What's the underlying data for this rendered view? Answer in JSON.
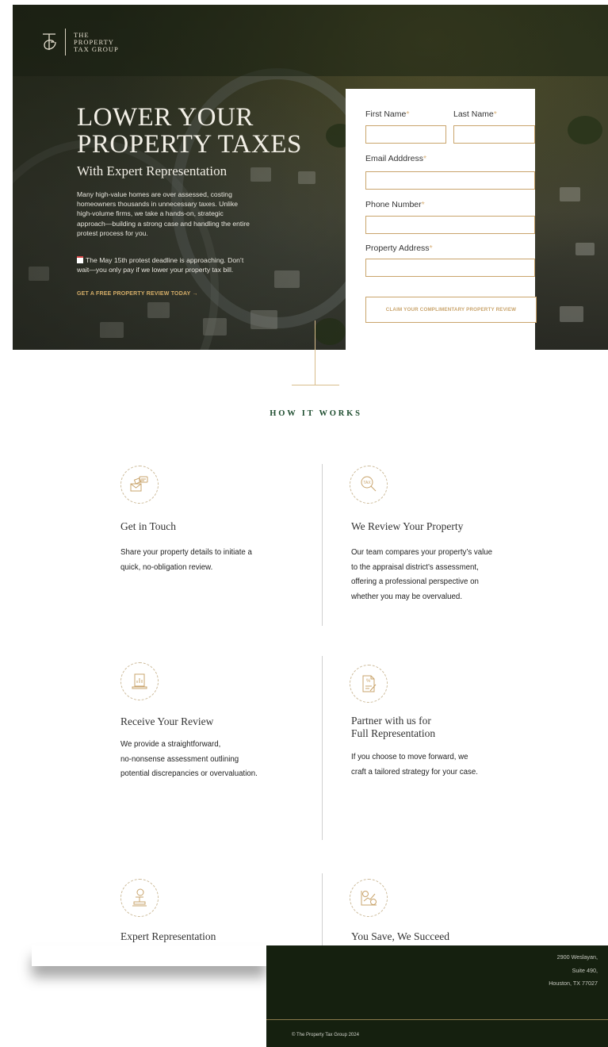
{
  "brand": {
    "logo_lines": [
      "THE",
      "PROPERTY",
      "TAX GROUP"
    ]
  },
  "hero": {
    "title_lines": [
      "LOWER YOUR",
      "PROPERTY TAXES"
    ],
    "subtitle": "With Expert Representation",
    "description_lines": [
      "Many high-value homes are over assessed, costing",
      "homeowners thousands in unnecessary taxes. Unlike",
      "high-volume firms, we take a hands-on, strategic",
      "approach—building a strong case and handling the entire",
      "protest process for you."
    ],
    "note_lines": [
      "The May 15th protest deadline is approaching. Don’t",
      "wait—you only pay if we lower your property tax bill."
    ],
    "note_icon": "calendar-icon",
    "cta": "GET A FREE PROPERTY REVIEW TODAY →"
  },
  "form": {
    "first_name_label": "First Name",
    "last_name_label": "Last Name",
    "email_label": "Email Adddress",
    "phone_label": "Phone Number",
    "address_label": "Property Address",
    "required_mark": "*",
    "first_name_value": "",
    "last_name_value": "",
    "email_value": "",
    "phone_value": "",
    "address_value": "",
    "submit_label": "CLAIM YOUR COMPLIMENTARY PROPERTY REVIEW"
  },
  "how_it_works": {
    "title": "HOW IT WORKS",
    "steps": [
      {
        "icon": "envelope-chat-icon",
        "title_lines": [
          "Get in Touch"
        ],
        "text_lines": [
          "Share your property details to initiate a",
          "quick, no-obligation review."
        ]
      },
      {
        "icon": "tax-magnifier-icon",
        "title_lines": [
          "We Review Your Property"
        ],
        "text_lines": [
          "Our team compares your property’s value",
          "to the appraisal district’s assessment,",
          "offering a professional perspective on",
          "whether you may be overvalued."
        ]
      },
      {
        "icon": "report-chart-icon",
        "title_lines": [
          "Receive Your Review"
        ],
        "text_lines": [
          "We provide a straightforward,",
          "no-nonsense assessment outlining",
          "potential discrepancies or overvaluation."
        ]
      },
      {
        "icon": "percent-document-icon",
        "title_lines": [
          "Partner with us for",
          "Full Representation"
        ],
        "text_lines": [
          "If you choose to move forward, we",
          "craft a tailored strategy for your case."
        ]
      },
      {
        "icon": "gavel-icon",
        "title_lines": [
          "Expert Representation"
        ],
        "text_lines": []
      },
      {
        "icon": "savings-growth-icon",
        "title_lines": [
          "You Save, We Succeed"
        ],
        "text_lines": []
      }
    ]
  },
  "footer": {
    "address_lines": [
      "2900 Weslayan,",
      "Suite 490,",
      "Houston, TX 77027"
    ],
    "copyright": "© The Property Tax Group 2024"
  },
  "colors": {
    "accent_gold": "#c9a46c",
    "heading_green": "#1e4d2f",
    "footer_bg": "#15200f",
    "required_mark": "#d9b27a"
  }
}
